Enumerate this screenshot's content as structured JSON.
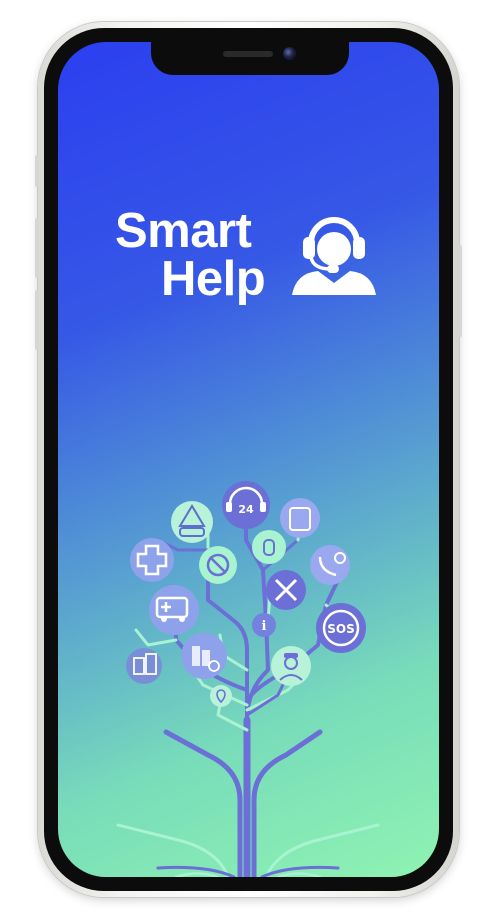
{
  "app": {
    "logo_line1": "Smart",
    "logo_line2": "Help",
    "logo_icon": "support-agent-icon"
  },
  "illustration": {
    "name": "service-tree-illustration",
    "icons": [
      "24-hour-support-icon",
      "warning-car-icon",
      "first-aid-cross-icon",
      "no-entry-icon",
      "fire-extinguisher-icon",
      "jerrycan-icon",
      "phone-contact-icon",
      "tools-icon",
      "ambulance-icon",
      "info-icon",
      "sos-icon",
      "buildings-icon",
      "city-info-icon",
      "police-icon",
      "location-pin-icon"
    ],
    "labels": {
      "support_hours": "24",
      "sos": "SOS",
      "info": "i"
    }
  },
  "colors": {
    "gradient_top": "#2b3ff0",
    "gradient_bottom": "#8ff3b2",
    "tree_violet": "#6b6fd6",
    "tree_mint": "#a8f3d0",
    "icon_bubble": "#8ea2ec",
    "logo_white": "#ffffff"
  }
}
